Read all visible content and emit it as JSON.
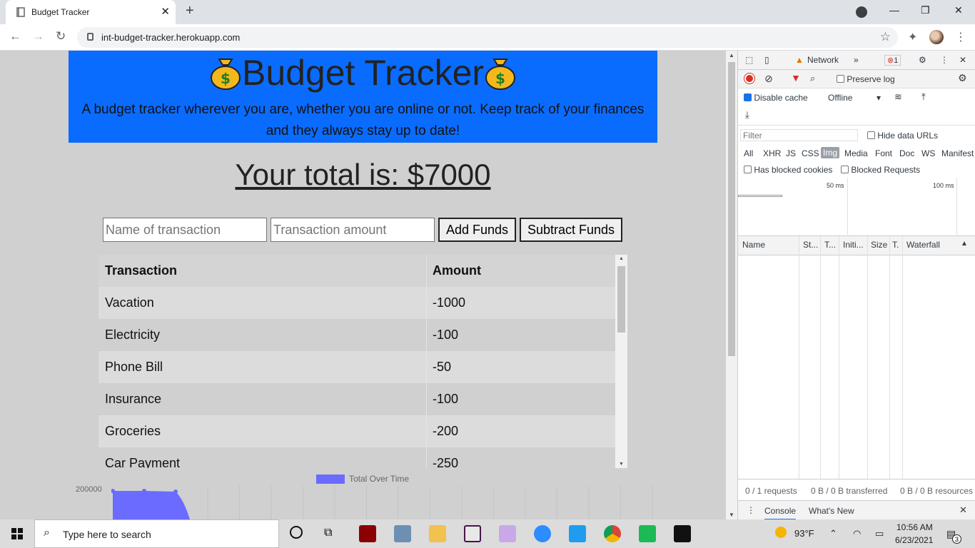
{
  "browser": {
    "tab_title": "Budget Tracker",
    "tab_close": "✕",
    "new_tab": "+",
    "url": "int-budget-tracker.herokuapp.com",
    "back": "←",
    "forward": "→",
    "reload": "↻",
    "star": "☆",
    "extensions": "✦",
    "menu": "⋮",
    "minimize": "—",
    "restore": "❐",
    "close": "✕"
  },
  "app": {
    "title": "Budget Tracker",
    "subtitle_line1": "A budget tracker wherever you are, whether you are online or not. Keep track of your finances",
    "subtitle_line2": "and they always stay up to date!",
    "total_text": "Your total is: $7000",
    "name_placeholder": "Name of transaction",
    "amount_placeholder": "Transaction amount",
    "add_label": "Add Funds",
    "subtract_label": "Subtract Funds",
    "table": {
      "headers": [
        "Transaction",
        "Amount"
      ],
      "rows": [
        [
          "Vacation",
          "-1000"
        ],
        [
          "Electricity",
          "-100"
        ],
        [
          "Phone Bill",
          "-50"
        ],
        [
          "Insurance",
          "-100"
        ],
        [
          "Groceries",
          "-200"
        ],
        [
          "Car Payment",
          "-250"
        ]
      ]
    }
  },
  "chart_data": {
    "type": "area",
    "legend": "Total Over Time",
    "y_ticks": [
      "200000"
    ],
    "series_color": "#6b6bff"
  },
  "devtools": {
    "active_tab": "Network",
    "more": "»",
    "error_count": "1",
    "preserve_log": "Preserve log",
    "disable_cache": "Disable cache",
    "throttling": "Offline",
    "filter_placeholder": "Filter",
    "hide_data_urls": "Hide data URLs",
    "types": [
      "All",
      "XHR",
      "JS",
      "CSS",
      "Img",
      "Media",
      "Font",
      "Doc",
      "WS",
      "Manifest"
    ],
    "selected_type": "Img",
    "has_blocked_cookies": "Has blocked cookies",
    "blocked_requests": "Blocked Requests",
    "overview_ticks": [
      "50 ms",
      "100 ms"
    ],
    "columns": [
      "Name",
      "St...",
      "T...",
      "Initi...",
      "Size",
      "T.",
      "Waterfall"
    ],
    "status_requests": "0 / 1 requests",
    "status_transferred": "0 B / 0 B transferred",
    "status_resources": "0 B / 0 B resources",
    "drawer_console": "Console",
    "drawer_whats_new": "What's New"
  },
  "taskbar": {
    "search_placeholder": "Type here to search",
    "weather": "93°F",
    "time": "10:56 AM",
    "date": "6/23/2021",
    "notifications": "3"
  },
  "colors": {
    "hero_bg": "#0a6cff",
    "page_bg": "#d0d0d0",
    "chart_fill": "#6b6bff"
  }
}
